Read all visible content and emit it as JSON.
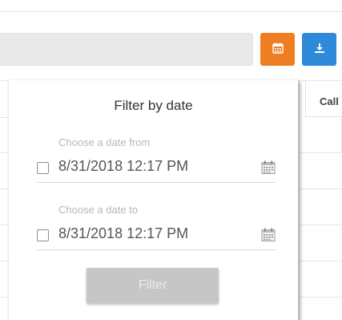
{
  "toolbar": {
    "calendar_button_icon": "calendar-icon",
    "download_button_icon": "download-icon",
    "calendar_color": "#ef7e22",
    "download_color": "#2e8ad8"
  },
  "table": {
    "columns": [
      "Call"
    ]
  },
  "filter_popup": {
    "title": "Filter by date",
    "from": {
      "label": "Choose a date from",
      "value": "8/31/2018 12:17 PM",
      "checked": false,
      "icon": "calendar-icon"
    },
    "to": {
      "label": "Choose a date to",
      "value": "8/31/2018 12:17 PM",
      "checked": false,
      "icon": "calendar-icon"
    },
    "filter_button": "Filter"
  }
}
